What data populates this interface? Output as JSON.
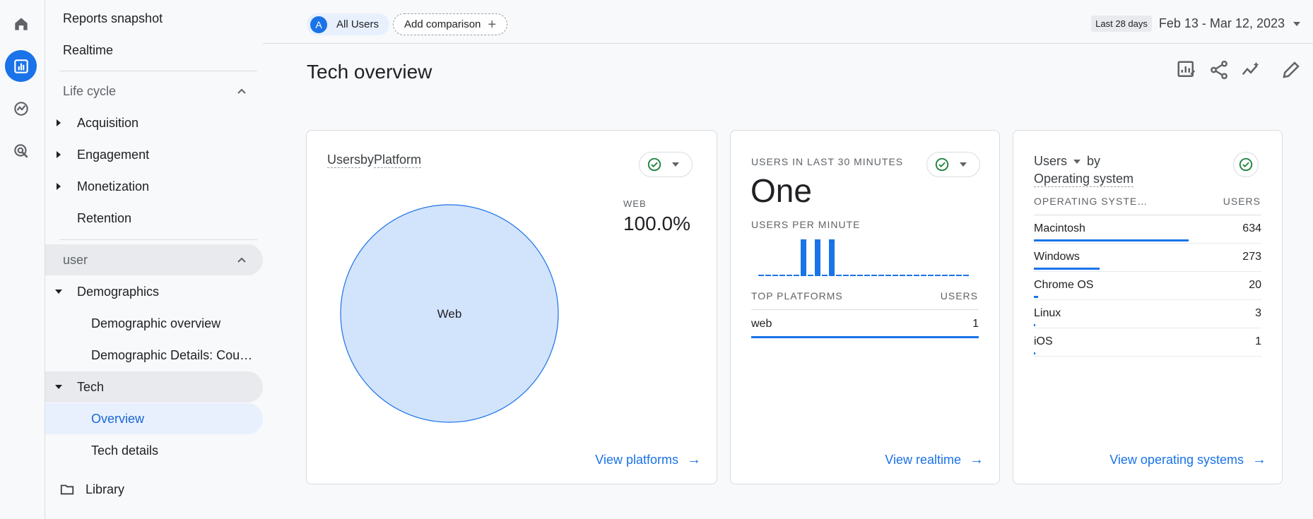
{
  "nav": {
    "reports_snapshot": "Reports snapshot",
    "realtime": "Realtime",
    "lifecycle": "Life cycle",
    "acquisition": "Acquisition",
    "engagement": "Engagement",
    "monetization": "Monetization",
    "retention": "Retention",
    "user": "user",
    "demographics": "Demographics",
    "demographic_overview": "Demographic overview",
    "demographic_details": "Demographic Details: Cou…",
    "tech": "Tech",
    "overview": "Overview",
    "tech_details": "Tech details",
    "library": "Library"
  },
  "topbar": {
    "users_avatar": "A",
    "users_chip": "All Users",
    "add_comparison": "Add comparison",
    "date_label": "Last 28 days",
    "date_range": "Feb 13 - Mar 12, 2023"
  },
  "page": {
    "title": "Tech overview"
  },
  "platform_card": {
    "title_a": "Users",
    "title_b": "by",
    "title_c": "Platform",
    "legend_label": "WEB",
    "legend_value": "100.0%",
    "slice_label": "Web",
    "link": "View platforms",
    "pie_fill_fraction": 1.0
  },
  "realtime_card": {
    "users_label": "USERS IN LAST 30 MINUTES",
    "users_value": "One",
    "per_minute_label": "USERS PER MINUTE",
    "per_minute_series": [
      0,
      0,
      0,
      0,
      0,
      0,
      1,
      0,
      1,
      0,
      1,
      0,
      0,
      0,
      0,
      0,
      0,
      0,
      0,
      0,
      0,
      0,
      0,
      0,
      0,
      0,
      0,
      0,
      0,
      0
    ],
    "top_platforms_label": "TOP PLATFORMS",
    "users_col": "USERS",
    "rows": [
      {
        "name": "web",
        "value": "1"
      }
    ],
    "link": "View realtime"
  },
  "os_card": {
    "title_a": "Users",
    "title_b": "by",
    "title_c": "Operating system",
    "col_os": "OPERATING SYSTE…",
    "col_users": "USERS",
    "rows": [
      {
        "name": "Macintosh",
        "value": "634",
        "share": 0.68
      },
      {
        "name": "Windows",
        "value": "273",
        "share": 0.29
      },
      {
        "name": "Chrome OS",
        "value": "20",
        "share": 0.02
      },
      {
        "name": "Linux",
        "value": "3",
        "share": 0.003
      },
      {
        "name": "iOS",
        "value": "1",
        "share": 0.001
      }
    ],
    "link": "View operating systems"
  },
  "colors": {
    "accent": "#1a73e8",
    "pie_fill": "#d2e3fc",
    "check": "#188038"
  }
}
